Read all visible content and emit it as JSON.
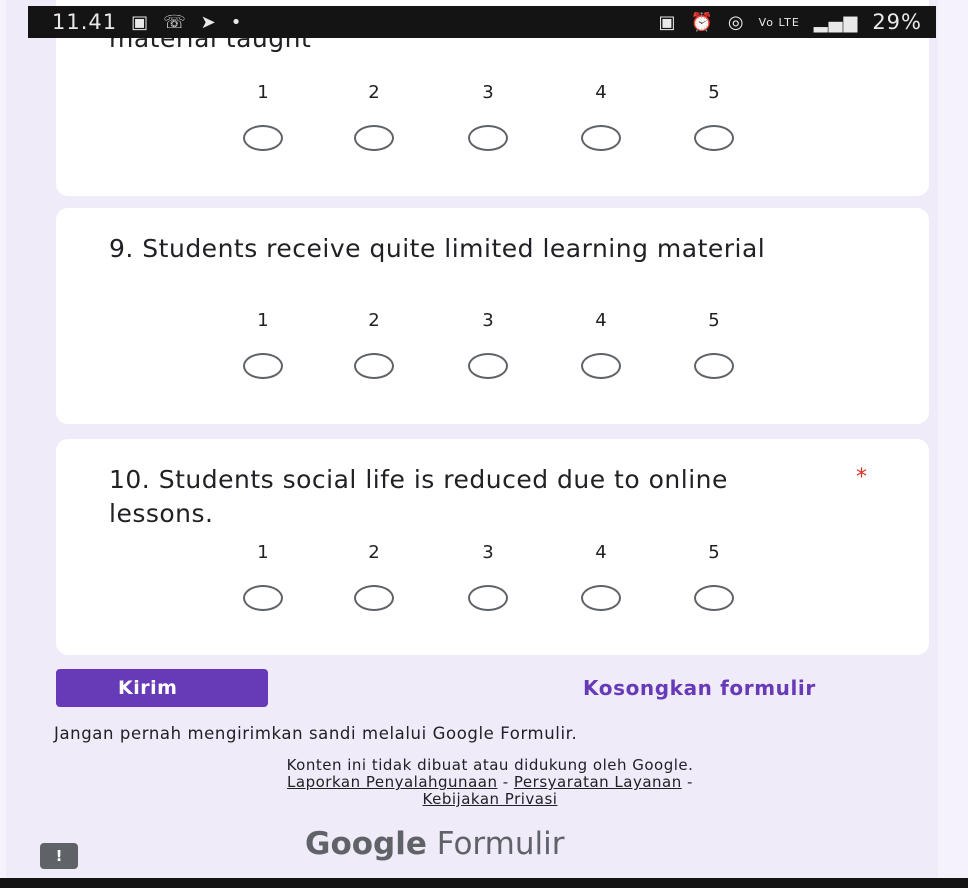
{
  "status_bar": {
    "time": "11.41",
    "left_icons": [
      "image-icon",
      "phone-icon",
      "telegram-icon",
      "dot-icon"
    ],
    "right_icons": [
      "nfc-icon",
      "alarm-icon",
      "hotspot-icon",
      "volte-icon",
      "signal-icon"
    ],
    "battery": "29%"
  },
  "questions": [
    {
      "text": "material taught",
      "required": false,
      "scale": [
        "1",
        "2",
        "3",
        "4",
        "5"
      ]
    },
    {
      "text": "9. Students receive quite limited learning material",
      "required": false,
      "scale": [
        "1",
        "2",
        "3",
        "4",
        "5"
      ]
    },
    {
      "text": "10. Students social life is reduced due to online lessons.",
      "required": true,
      "required_mark": "*",
      "scale": [
        "1",
        "2",
        "3",
        "4",
        "5"
      ]
    }
  ],
  "actions": {
    "submit_label": "Kirim",
    "clear_label": "Kosongkan formulir"
  },
  "footer": {
    "warning": "Jangan pernah mengirimkan sandi melalui Google Formulir.",
    "disclaimer": "Konten ini tidak dibuat atau didukung oleh Google.",
    "report_link": "Laporkan Penyalahgunaan",
    "sep1": " - ",
    "terms_link": "Persyaratan Layanan",
    "sep2": " -",
    "privacy_link": "Kebijakan Privasi",
    "brand_bold": "Google",
    "brand_light": " Formulir",
    "feedback_icon": "feedback-icon"
  },
  "colors": {
    "accent": "#673ab7",
    "background": "#f0ebf8",
    "required": "#d93025"
  }
}
